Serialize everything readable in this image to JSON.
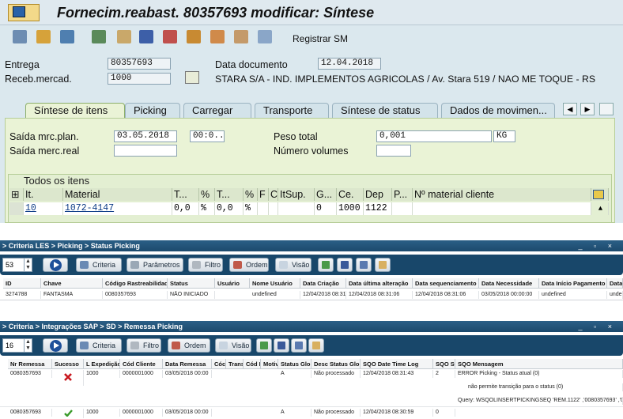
{
  "sap": {
    "title": "Fornecim.reabast. 80357693 modificar: Síntese",
    "toolbar_register": "Registrar SM",
    "entrega_label": "Entrega",
    "entrega_value": "80357693",
    "receb_label": "Receb.mercad.",
    "receb_value": "1000",
    "data_doc_label": "Data documento",
    "data_doc_value": "12.04.2018",
    "address": "STARA S/A - IND. IMPLEMENTOS AGRICOLAS / Av. Stara 519 / NAO ME TOQUE - RS",
    "tabs": [
      "Síntese de itens",
      "Picking",
      "Carregar",
      "Transporte",
      "Síntese de status",
      "Dados de movimen..."
    ],
    "saida_plan_label": "Saída mrc.plan.",
    "saida_plan_date": "03.05.2018",
    "saida_plan_time": "00:0..",
    "saida_real_label": "Saída merc.real",
    "peso_label": "Peso total",
    "peso_value": "0,001",
    "peso_unit": "KG",
    "num_vol_label": "Número volumes",
    "items_title": "Todos os itens",
    "item_headers": [
      "It.",
      "Material",
      "T...",
      "%",
      "T...",
      "%",
      "F",
      "C",
      "ItSup.",
      "G...",
      "Ce.",
      "Dep",
      "P...",
      "Nº material cliente"
    ],
    "item_row": [
      "10",
      "1072-4147",
      "0,0",
      "%",
      "0,0",
      "%",
      "",
      "",
      "",
      "0",
      "1000",
      "1122",
      "",
      ""
    ]
  },
  "panel1": {
    "breadcrumb": "> Criteria LES > Picking > Status Picking",
    "count": "53",
    "buttons": [
      "Criteria",
      "Parâmetros",
      "Filtro",
      "Ordem",
      "Visão"
    ],
    "headers": [
      "ID",
      "Chave",
      "Código Rastreabilidade",
      "Status",
      "Usuário",
      "Nome Usuário",
      "Data Criação",
      "Data última alteração",
      "Data sequenciamento",
      "Data Necessidade",
      "Data Início Pagamento",
      "Data"
    ],
    "row": [
      "3274788",
      "FANTASMA",
      "0080357693",
      "NÃO INICIADO",
      "",
      "undefined",
      "12/04/2018 08:31",
      "12/04/2018 08:31:06",
      "12/04/2018 08:31:06",
      "03/05/2018 00:00:00",
      "undefined",
      "unde"
    ]
  },
  "panel2": {
    "breadcrumb": "> Criteria > Integrações SAP > SD > Remessa Picking",
    "count": "16",
    "buttons": [
      "Criteria",
      "Filtro",
      "Ordem",
      "Visão"
    ],
    "headers": [
      "Nr Remessa",
      "Sucesso",
      "L Expedição",
      "Cód Cliente",
      "Data Remessa",
      "Cóc",
      "Trans",
      "Cód M",
      "Motiv",
      "Status Glob",
      "Desc Status Glob",
      "SQO Date Time Log",
      "SQO Sta",
      "SQO Mensagem"
    ],
    "rows": [
      {
        "nr": "0080357693",
        "ok": false,
        "lexp": "1000",
        "cli": "0000001000",
        "data": "03/05/2018 00:00",
        "status": "A",
        "desc": "Não processado",
        "log": "12/04/2018 08:31:43",
        "sta": "2",
        "msg1": "ERROR Picking - Status atual (0)",
        "msg2": "não permite transição para o status (0)",
        "msg3": "Query: WSQOLINSERTPICKINGSEQ  'REM.1122' ,'0080357693' ,'03"
      },
      {
        "nr": "0080357693",
        "ok": true,
        "lexp": "1000",
        "cli": "0000001000",
        "data": "03/05/2018 00:00",
        "status": "A",
        "desc": "Não processado",
        "log": "12/04/2018 08:30:59",
        "sta": "0"
      }
    ]
  },
  "colors": {
    "sap_bg": "#dbe8ee",
    "panel_bar": "#18476a",
    "error": "#c8161d",
    "success": "#3a9a2a"
  }
}
